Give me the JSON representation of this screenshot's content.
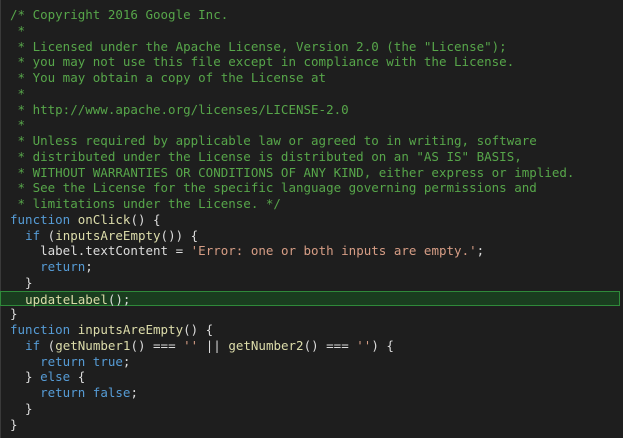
{
  "editor": {
    "theme_colors": {
      "background": "#1e1e1e",
      "comment": "#57a64a",
      "keyword": "#569cd6",
      "function": "#dcdcaa",
      "string": "#d69d85",
      "plain": "#dcdcdc",
      "highlight_bg": "#1a3d1f",
      "highlight_border": "#2f8a3a"
    },
    "lines": [
      {
        "kind": "comment",
        "text": "/* Copyright 2016 Google Inc."
      },
      {
        "kind": "comment",
        "text": " *"
      },
      {
        "kind": "comment",
        "text": " * Licensed under the Apache License, Version 2.0 (the \"License\");"
      },
      {
        "kind": "comment",
        "text": " * you may not use this file except in compliance with the License."
      },
      {
        "kind": "comment",
        "text": " * You may obtain a copy of the License at"
      },
      {
        "kind": "comment",
        "text": " *"
      },
      {
        "kind": "comment",
        "text": " * http://www.apache.org/licenses/LICENSE-2.0"
      },
      {
        "kind": "comment",
        "text": " *"
      },
      {
        "kind": "comment",
        "text": " * Unless required by applicable law or agreed to in writing, software"
      },
      {
        "kind": "comment",
        "text": " * distributed under the License is distributed on an \"AS IS\" BASIS,"
      },
      {
        "kind": "comment",
        "text": " * WITHOUT WARRANTIES OR CONDITIONS OF ANY KIND, either express or implied."
      },
      {
        "kind": "comment",
        "text": " * See the License for the specific language governing permissions and"
      },
      {
        "kind": "comment",
        "text": " * limitations under the License. */"
      },
      {
        "kind": "code",
        "tokens": [
          [
            "kw",
            "function"
          ],
          [
            "pl",
            " "
          ],
          [
            "fn",
            "onClick"
          ],
          [
            "pl",
            "() {"
          ]
        ]
      },
      {
        "kind": "code",
        "tokens": [
          [
            "pl",
            "  "
          ],
          [
            "kw",
            "if"
          ],
          [
            "pl",
            " ("
          ],
          [
            "fn",
            "inputsAreEmpty"
          ],
          [
            "pl",
            "()) {"
          ]
        ]
      },
      {
        "kind": "code",
        "tokens": [
          [
            "pl",
            "    label."
          ],
          [
            "prop",
            "textContent"
          ],
          [
            "pl",
            " = "
          ],
          [
            "str",
            "'Error: one or both inputs are empty.'"
          ],
          [
            "pl",
            ";"
          ]
        ]
      },
      {
        "kind": "code",
        "tokens": [
          [
            "pl",
            "    "
          ],
          [
            "kw",
            "return"
          ],
          [
            "pl",
            ";"
          ]
        ]
      },
      {
        "kind": "code",
        "tokens": [
          [
            "pl",
            "  }"
          ]
        ]
      },
      {
        "kind": "code",
        "highlight": true,
        "tokens": [
          [
            "pl",
            "  "
          ],
          [
            "fn",
            "updateLabel"
          ],
          [
            "pl",
            "();"
          ]
        ]
      },
      {
        "kind": "code",
        "tokens": [
          [
            "pl",
            "}"
          ]
        ]
      },
      {
        "kind": "code",
        "tokens": [
          [
            "kw",
            "function"
          ],
          [
            "pl",
            " "
          ],
          [
            "fn",
            "inputsAreEmpty"
          ],
          [
            "pl",
            "() {"
          ]
        ]
      },
      {
        "kind": "code",
        "tokens": [
          [
            "pl",
            "  "
          ],
          [
            "kw",
            "if"
          ],
          [
            "pl",
            " ("
          ],
          [
            "fn",
            "getNumber1"
          ],
          [
            "pl",
            "() === "
          ],
          [
            "str",
            "''"
          ],
          [
            "pl",
            " || "
          ],
          [
            "fn",
            "getNumber2"
          ],
          [
            "pl",
            "() === "
          ],
          [
            "str",
            "''"
          ],
          [
            "pl",
            ") {"
          ]
        ]
      },
      {
        "kind": "code",
        "tokens": [
          [
            "pl",
            "    "
          ],
          [
            "kw",
            "return"
          ],
          [
            "pl",
            " "
          ],
          [
            "kw",
            "true"
          ],
          [
            "pl",
            ";"
          ]
        ]
      },
      {
        "kind": "code",
        "tokens": [
          [
            "pl",
            "  } "
          ],
          [
            "kw",
            "else"
          ],
          [
            "pl",
            " {"
          ]
        ]
      },
      {
        "kind": "code",
        "tokens": [
          [
            "pl",
            "    "
          ],
          [
            "kw",
            "return"
          ],
          [
            "pl",
            " "
          ],
          [
            "kw",
            "false"
          ],
          [
            "pl",
            ";"
          ]
        ]
      },
      {
        "kind": "code",
        "tokens": [
          [
            "pl",
            "  }"
          ]
        ]
      },
      {
        "kind": "code",
        "tokens": [
          [
            "pl",
            "}"
          ]
        ]
      }
    ]
  }
}
